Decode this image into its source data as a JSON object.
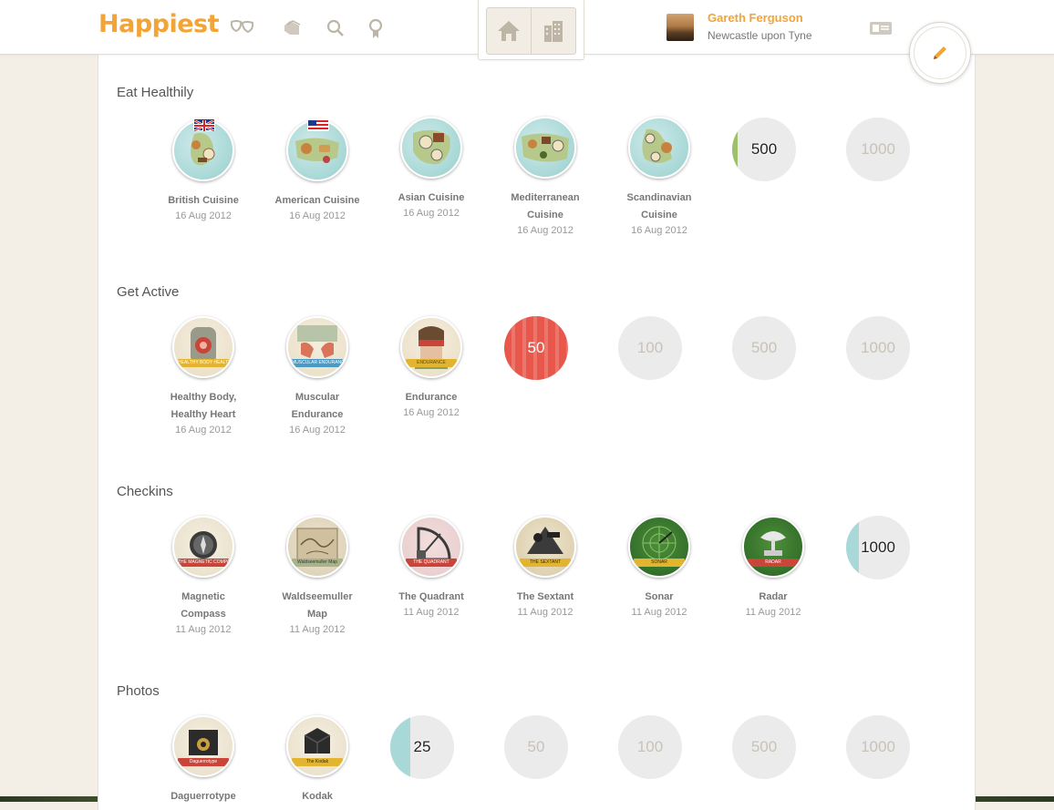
{
  "header": {
    "logo": "Happiest",
    "nav_icons": [
      "masks-icon",
      "tag-icon",
      "search-icon",
      "award-icon"
    ],
    "centre_tabs": [
      "home-icon",
      "city-icon"
    ],
    "user": {
      "name": "Gareth Ferguson",
      "location": "Newcastle upon Tyne"
    },
    "profile_card_icon": "id-card-icon",
    "compose_icon": "pencil-icon"
  },
  "colors": {
    "brand": "#f2a437",
    "earned_green": "#9ec06a",
    "earned_red": "#e8574c",
    "earned_teal": "#a9d8d8",
    "locked": "#ebebeb"
  },
  "sections": [
    {
      "title": "Eat Healthily",
      "badges": [
        {
          "name": "British Cuisine",
          "date": "16 Aug 2012"
        },
        {
          "name": "American Cuisine",
          "date": "16 Aug 2012"
        },
        {
          "name": "Asian Cuisine",
          "date": "16 Aug 2012"
        },
        {
          "name": "Mediterranean Cuisine",
          "date": "16 Aug 2012"
        },
        {
          "name": "Scandinavian Cuisine",
          "date": "16 Aug 2012"
        }
      ],
      "milestones": [
        {
          "value": "500",
          "progress": 0.08,
          "color": "#9ec06a"
        },
        {
          "value": "1000",
          "progress": 0,
          "color": ""
        }
      ]
    },
    {
      "title": "Get Active",
      "badges": [
        {
          "name": "Healthy Body, Healthy Heart",
          "date": "16 Aug 2012",
          "ribbon": "HEALTHY BODY HEALTHY HEART"
        },
        {
          "name": "Muscular Endurance",
          "date": "16 Aug 2012",
          "ribbon": "MUSCULAR ENDURANCE"
        },
        {
          "name": "Endurance",
          "date": "16 Aug 2012",
          "ribbon": "ENDURANCE"
        }
      ],
      "milestones": [
        {
          "value": "50",
          "progress": 1.0,
          "color": "#e8574c"
        },
        {
          "value": "100",
          "progress": 0,
          "color": ""
        },
        {
          "value": "500",
          "progress": 0,
          "color": ""
        },
        {
          "value": "1000",
          "progress": 0,
          "color": ""
        }
      ]
    },
    {
      "title": "Checkins",
      "badges": [
        {
          "name": "Magnetic Compass",
          "date": "11 Aug 2012",
          "ribbon": "THE MAGNETIC COMPASS"
        },
        {
          "name": "Waldseemuller Map",
          "date": "11 Aug 2012",
          "ribbon": "Waldseemuller Map"
        },
        {
          "name": "The Quadrant",
          "date": "11 Aug 2012",
          "ribbon": "THE QUADRANT"
        },
        {
          "name": "The Sextant",
          "date": "11 Aug 2012",
          "ribbon": "THE SEXTANT"
        },
        {
          "name": "Sonar",
          "date": "11 Aug 2012",
          "ribbon": "SONAR"
        },
        {
          "name": "Radar",
          "date": "11 Aug 2012",
          "ribbon": "RADAR"
        }
      ],
      "milestones": [
        {
          "value": "1000",
          "progress": 0.2,
          "color": "#a9d8d8"
        }
      ]
    },
    {
      "title": "Photos",
      "badges": [
        {
          "name": "Daguerrotype",
          "date": "",
          "ribbon": "Daguerrotype"
        },
        {
          "name": "Kodak",
          "date": "",
          "ribbon": "The Kodak"
        }
      ],
      "milestones": [
        {
          "value": "25",
          "progress": 0.32,
          "color": "#a9d8d8"
        },
        {
          "value": "50",
          "progress": 0,
          "color": ""
        },
        {
          "value": "100",
          "progress": 0,
          "color": ""
        },
        {
          "value": "500",
          "progress": 0,
          "color": ""
        },
        {
          "value": "1000",
          "progress": 0,
          "color": ""
        }
      ]
    }
  ]
}
